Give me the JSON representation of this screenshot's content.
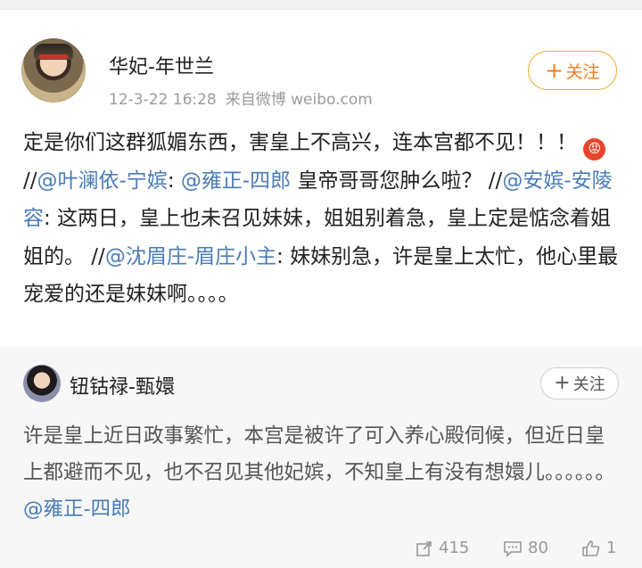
{
  "post": {
    "username": "华妃-年世兰",
    "timestamp": "12-3-22 16:28",
    "source": "来自微博 weibo.com",
    "follow_label": "关注",
    "text_1": "定是你们这群狐媚东西，害皇上不高兴，连本宫都不见！！！ ",
    "emoji_icon": "angry-face-icon",
    "text_2": "//",
    "mention_1": "@叶澜依-宁嫔",
    "text_3": ": ",
    "mention_2": "@雍正-四郎",
    "text_4": " 皇帝哥哥您肿么啦？ //",
    "mention_3": "@安嫔-安陵容",
    "text_5": ": 这两日，皇上也未召见妹妹，姐姐别着急，皇上定是惦念着姐姐的。 //",
    "mention_4": "@沈眉庄-眉庄小主",
    "text_6": ": 妹妹别急，许是皇上太忙，他心里最宠爱的还是妹妹啊。。。。"
  },
  "repost": {
    "username": "钮钴禄-甄嬛",
    "follow_label": "关注",
    "text": "许是皇上近日政事繁忙，本宫是被许了可入养心殿伺候，但近日皇上都避而不见，也不召见其他妃嫔，不知皇上有没有想嬛儿。。。。。。 ",
    "mention": "@雍正-四郎",
    "repost_count": "415",
    "comment_count": "80",
    "like_count": "1"
  },
  "colors": {
    "mention": "#4a7bb7",
    "follow_accent": "#f37b1d",
    "repost_bg": "#f7f7f7"
  }
}
